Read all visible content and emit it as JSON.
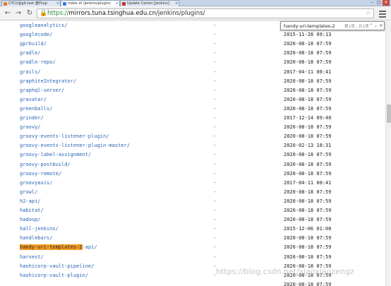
{
  "tabs": [
    {
      "title": "CYCU@git-test 盘Plugi",
      "active": false,
      "favicon_color": "#e07b2c"
    },
    {
      "title": "Index of /jenkins/plugins",
      "active": true,
      "favicon_color": "#3a7bd5"
    },
    {
      "title": "Update Center [Jenkins]",
      "active": false,
      "favicon_color": "#c0392b"
    }
  ],
  "window_buttons": {
    "minimize": "–",
    "maximize": "□",
    "close": "✕"
  },
  "toolbar": {
    "back_icon": "arrow-left-icon",
    "forward_icon": "arrow-right-icon",
    "reload_icon": "reload-icon",
    "url_protocol": "https://",
    "url_host": "mirrors.tuna.tsinghua.edu.cn",
    "url_path": "/jenkins/plugins/"
  },
  "find": {
    "query": "handy-uri-templates-2",
    "count": "第1项，共1项",
    "prev": "⌃",
    "next": "⌄",
    "close": "✕"
  },
  "listing": [
    {
      "name": "googleanalytics/",
      "size": "-",
      "date": ""
    },
    {
      "name": "googlecode/",
      "size": "-",
      "date": "2015-11-28 09:13"
    },
    {
      "name": "gprbuild/",
      "size": "-",
      "date": "2020-08-18 07:59"
    },
    {
      "name": "gradle/",
      "size": "-",
      "date": "2020-08-18 07:59"
    },
    {
      "name": "gradle-repo/",
      "size": "-",
      "date": "2020-08-18 07:59"
    },
    {
      "name": "grails/",
      "size": "-",
      "date": "2017-04-11 00:41"
    },
    {
      "name": "graphiteIntegrator/",
      "size": "-",
      "date": "2020-08-18 07:59"
    },
    {
      "name": "graphql-server/",
      "size": "-",
      "date": "2020-08-18 07:59"
    },
    {
      "name": "gravatar/",
      "size": "-",
      "date": "2020-08-18 07:59"
    },
    {
      "name": "greenballs/",
      "size": "-",
      "date": "2020-08-18 07:59"
    },
    {
      "name": "grinder/",
      "size": "-",
      "date": "2017-12-14 09:40"
    },
    {
      "name": "groovy/",
      "size": "-",
      "date": "2020-08-18 07:59"
    },
    {
      "name": "groovy-events-listener-plugin/",
      "size": "-",
      "date": "2020-08-18 07:59"
    },
    {
      "name": "groovy-events-listener-plugin-master/",
      "size": "-",
      "date": "2020-02-13 18:31"
    },
    {
      "name": "groovy-label-assignment/",
      "size": "-",
      "date": "2020-08-18 07:59"
    },
    {
      "name": "groovy-postbuild/",
      "size": "-",
      "date": "2020-08-18 07:59"
    },
    {
      "name": "groovy-remote/",
      "size": "-",
      "date": "2020-08-18 07:59"
    },
    {
      "name": "groovyaxis/",
      "size": "-",
      "date": "2017-04-11 00:41"
    },
    {
      "name": "growl/",
      "size": "-",
      "date": "2020-08-18 07:59"
    },
    {
      "name": "h2-api/",
      "size": "-",
      "date": "2020-08-18 07:59"
    },
    {
      "name": "habitat/",
      "size": "-",
      "date": "2020-08-18 07:59"
    },
    {
      "name": "hadoop/",
      "size": "-",
      "date": "2020-08-18 07:59"
    },
    {
      "name": "hall-jenkins/",
      "size": "-",
      "date": "2015-12-06 01:00"
    },
    {
      "name": "handlebars/",
      "size": "-",
      "date": "2020-08-18 07:59"
    },
    {
      "name": "handy-uri-templates-2-api/",
      "size": "-",
      "date": "2020-08-18 07:59",
      "highlight": "handy-uri-templates-2"
    },
    {
      "name": "harvest/",
      "size": "-",
      "date": "2020-08-18 07:59"
    },
    {
      "name": "hashicorp-vault-pipeline/",
      "size": "-",
      "date": "2020-08-18 07:59"
    },
    {
      "name": "hashicorp-vault-plugin/",
      "size": "-",
      "date": "2020-08-18 07:59"
    },
    {
      "name": "",
      "size": "",
      "date": "2020-08-18 07:59"
    }
  ],
  "watermark": "https://blog.csdn.net/xiaoxiaozengz"
}
